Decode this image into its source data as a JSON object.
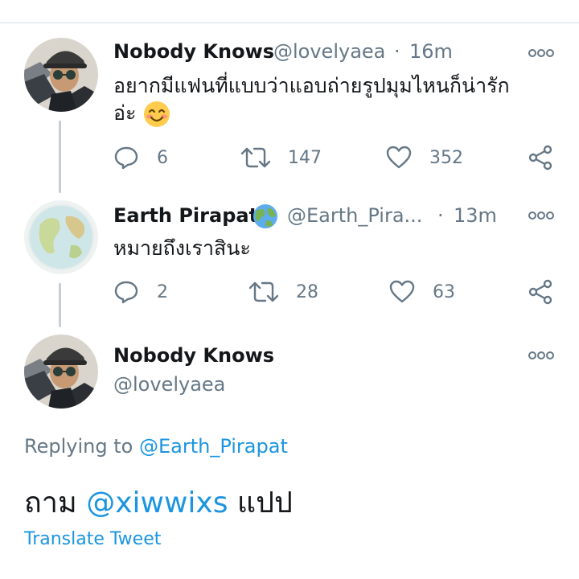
{
  "tweet1": {
    "name": "Nobody Knows",
    "handle": "@lovelyaea",
    "sep": "·",
    "time": "16m",
    "text_line1": "อยากมีแฟนที่แบบว่าแอบถ่ายรูปมุมไหนก็น่ารัก",
    "text_line2": "อ่ะ",
    "emoji_icon": "smiling-face-icon",
    "replies": "6",
    "retweets": "147",
    "likes": "352"
  },
  "tweet2": {
    "name": "Earth Pirapat",
    "badge_icon": "globe-icon",
    "handle": "@Earth_Pira...",
    "sep": "·",
    "time": "13m",
    "text": "หมายถึงเราสินะ",
    "replies": "2",
    "retweets": "28",
    "likes": "63"
  },
  "main_tweet": {
    "name": "Nobody Knows",
    "handle": "@lovelyaea",
    "replying_prefix": "Replying to",
    "replying_to": "@Earth_Pirapat",
    "text_start": "ถาม",
    "mention": "@xiwwixs",
    "text_end": "แปป",
    "translate": "Translate Tweet"
  },
  "colors": {
    "link": "#1b95e0",
    "secondary_text": "#657786",
    "thread_line": "#c4cfd6"
  }
}
